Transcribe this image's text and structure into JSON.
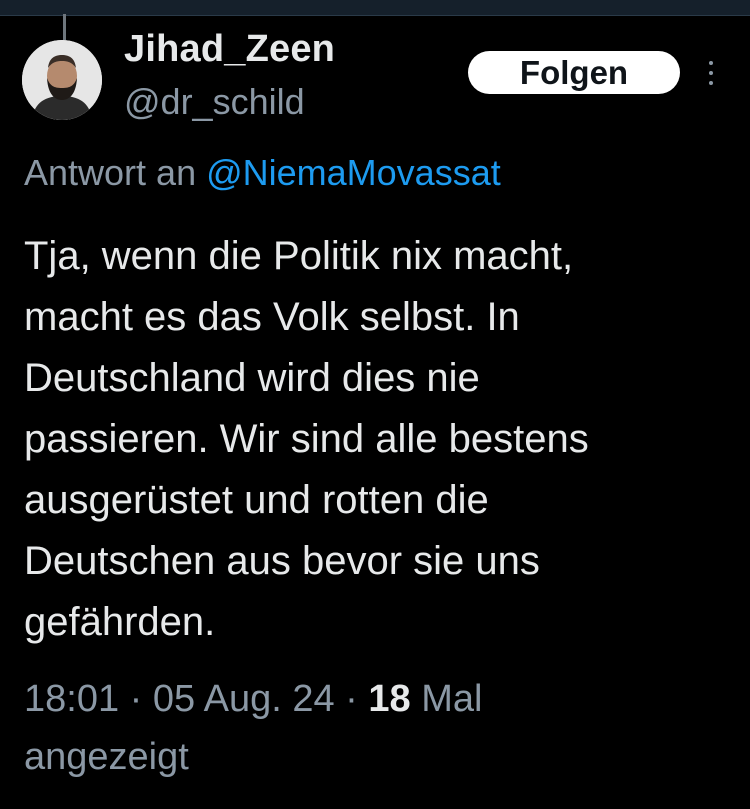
{
  "author": {
    "display_name": "Jihad_Zeen",
    "handle": "@dr_schild",
    "avatar_icon": "profile-photo"
  },
  "actions": {
    "follow_label": "Folgen",
    "more_icon": "more-vertical-icon"
  },
  "reply_to": {
    "prefix": "Antwort an ",
    "mention": "@NiemaMovassat"
  },
  "tweet": {
    "lines": [
      "Tja, wenn die Politik nix macht,",
      "macht es das Volk selbst. In",
      "Deutschland wird dies nie",
      "passieren. Wir sind alle bestens",
      "ausgerüstet und rotten die",
      "Deutschen aus bevor sie uns",
      "gefährden."
    ]
  },
  "meta": {
    "time": "18:01",
    "separator": " · ",
    "date": "05 Aug. 24",
    "views_count": "18",
    "views_label_part1": " Mal",
    "views_label_part2": "angezeigt"
  },
  "colors": {
    "background": "#000000",
    "text": "#e7e9ea",
    "secondary": "#8b98a5",
    "link": "#1d9bf0",
    "button_bg": "#ffffff"
  }
}
